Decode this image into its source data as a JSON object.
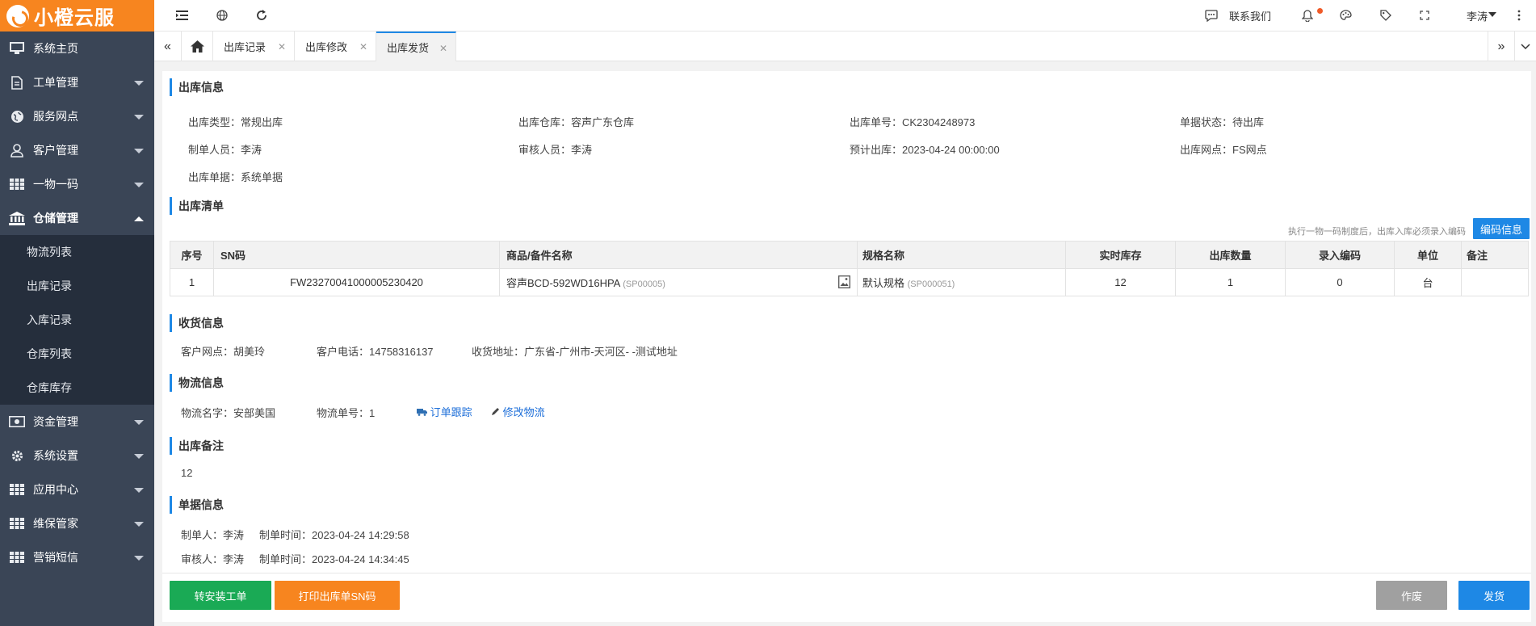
{
  "app": {
    "logo_text": "小橙云服"
  },
  "sidebar": {
    "items": [
      {
        "label": "系统主页",
        "icon": "monitor-icon"
      },
      {
        "label": "工单管理",
        "icon": "document-icon"
      },
      {
        "label": "服务网点",
        "icon": "globe-icon"
      },
      {
        "label": "客户管理",
        "icon": "user-icon"
      },
      {
        "label": "一物一码",
        "icon": "grid-icon"
      },
      {
        "label": "仓储管理",
        "icon": "bank-icon"
      },
      {
        "label": "资金管理",
        "icon": "money-icon"
      },
      {
        "label": "系统设置",
        "icon": "gear-icon"
      },
      {
        "label": "应用中心",
        "icon": "grid-icon"
      },
      {
        "label": "维保管家",
        "icon": "grid-icon"
      },
      {
        "label": "营销短信",
        "icon": "grid-icon"
      }
    ],
    "submenu": [
      "物流列表",
      "出库记录",
      "入库记录",
      "仓库列表",
      "仓库库存"
    ]
  },
  "topbar": {
    "contact": "联系我们",
    "user": "李涛"
  },
  "tabs": [
    {
      "label": "出库记录"
    },
    {
      "label": "出库修改"
    },
    {
      "label": "出库发货"
    }
  ],
  "outbound_info": {
    "title": "出库信息",
    "fields": [
      "出库类型：常规出库",
      "出库仓库：容声广东仓库",
      "出库单号：CK2304248973",
      "单据状态：待出库",
      "制单人员：李涛",
      "审核人员：李涛",
      "预计出库：2023-04-24 00:00:00",
      "出库网点：FS网点",
      "出库单据：系统单据"
    ]
  },
  "outbound_list": {
    "title": "出库清单",
    "note": "执行一物一码制度后，出库入库必须录入编码",
    "code_button": "编码信息",
    "headers": [
      "序号",
      "SN码",
      "商品/备件名称",
      "规格名称",
      "实时库存",
      "出库数量",
      "录入编码",
      "单位",
      "备注"
    ],
    "rows": [
      {
        "index": "1",
        "sn": "FW2327004100000523042​0",
        "name": "容声BCD-592WD16HPA",
        "name_code": "(SP00005)",
        "spec": "默认规格",
        "spec_code": "(SP000051)",
        "stock": "12",
        "qty": "1",
        "coded": "0",
        "unit": "台",
        "remark": ""
      }
    ]
  },
  "receiver": {
    "title": "收货信息",
    "outlet": "客户网点：胡美玲",
    "phone": "客户电话：14758316137",
    "address": "收货地址：广东省-广州市-天河区- -测试地址"
  },
  "logistics": {
    "title": "物流信息",
    "name": "物流名字：安部美国",
    "number": "物流单号：1",
    "track": "订单跟踪",
    "edit": "修改物流"
  },
  "remark": {
    "title": "出库备注",
    "value": "12"
  },
  "doc_info": {
    "title": "单据信息",
    "creator": "制单人：李涛",
    "create_time": "制单时间：2023-04-24 14:29:58",
    "reviewer": "审核人：李涛",
    "review_time": "制单时间：2023-04-24 14:34:45"
  },
  "actions": {
    "to_install": "转安装工单",
    "print_sn": "打印出库单SN码",
    "void": "作废",
    "ship": "发货"
  },
  "colors": {
    "brand_orange": "#f7851f",
    "sidebar_bg": "#3a4556",
    "primary_blue": "#1e88e5",
    "green": "#1aaa55",
    "gray": "#a0a0a0"
  }
}
